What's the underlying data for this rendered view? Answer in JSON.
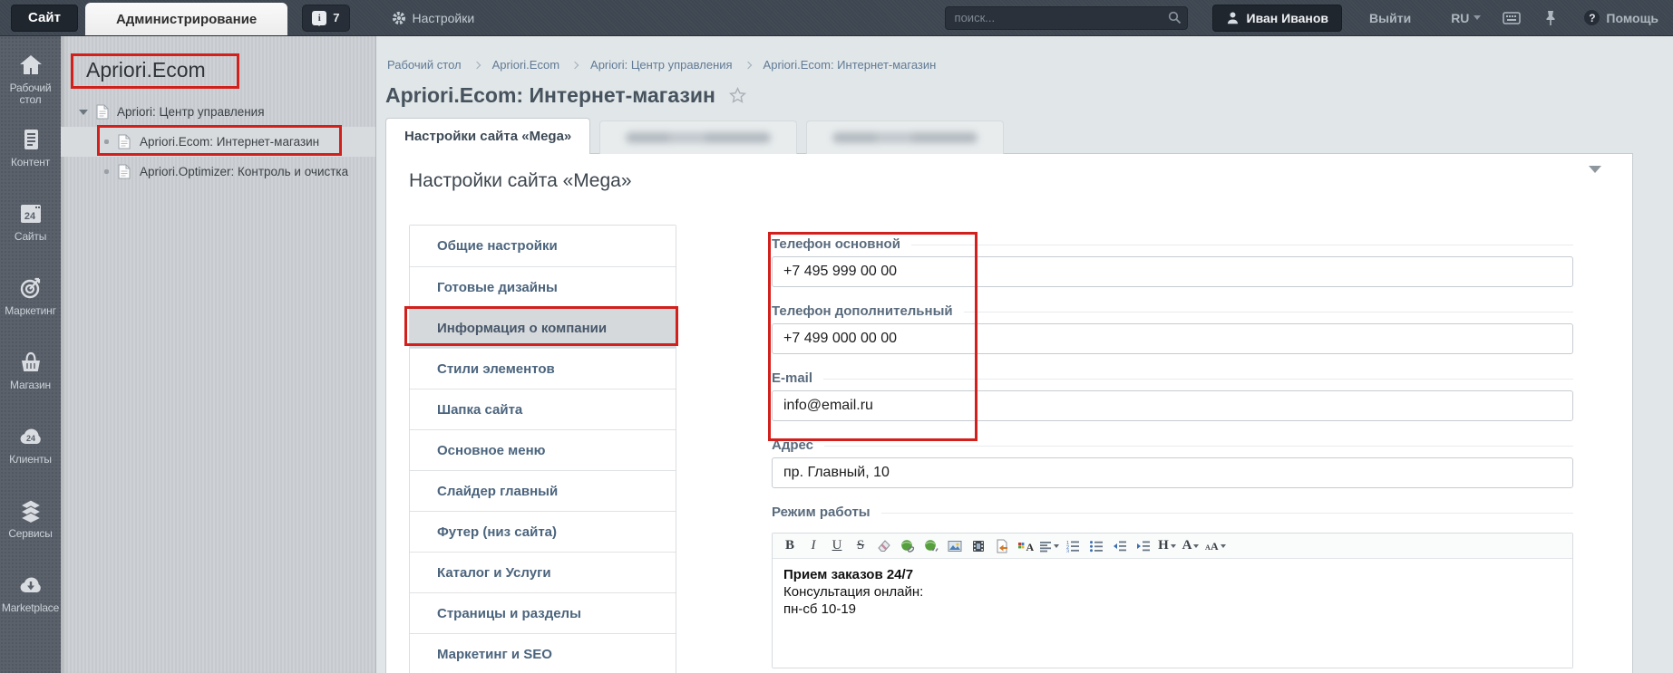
{
  "topbar": {
    "site_tab": "Сайт",
    "admin_tab": "Администрирование",
    "notification_count": "7",
    "settings_label": "Настройки",
    "search_placeholder": "поиск...",
    "user_name": "Иван Иванов",
    "logout_label": "Выйти",
    "language": "RU",
    "help_label": "Помощь"
  },
  "sidebar": {
    "items": [
      {
        "label": "Рабочий стол",
        "icon": "home-icon"
      },
      {
        "label": "Контент",
        "icon": "content-icon"
      },
      {
        "label": "Сайты",
        "icon": "sites-icon",
        "badge": "24"
      },
      {
        "label": "Маркетинг",
        "icon": "marketing-icon"
      },
      {
        "label": "Магазин",
        "icon": "store-icon"
      },
      {
        "label": "Клиенты",
        "icon": "clients-icon",
        "badge": "24"
      },
      {
        "label": "Сервисы",
        "icon": "services-icon"
      },
      {
        "label": "Marketplace",
        "icon": "marketplace-icon"
      }
    ]
  },
  "tree": {
    "title": "Apriori.Ecom",
    "items": [
      {
        "label": "Apriori: Центр управления",
        "selected": false
      },
      {
        "label": "Apriori.Ecom: Интернет-магазин",
        "selected": true
      },
      {
        "label": "Apriori.Optimizer: Контроль и очистка",
        "selected": false
      }
    ]
  },
  "breadcrumb": {
    "items": [
      "Рабочий стол",
      "Apriori.Ecom",
      "Apriori: Центр управления",
      "Apriori.Ecom: Интернет-магазин"
    ]
  },
  "page": {
    "title": "Apriori.Ecom: Интернет-магазин"
  },
  "tabs": [
    {
      "label": "Настройки сайта «Mega»",
      "active": true,
      "blurred": false
    },
    {
      "label": "",
      "active": false,
      "blurred": true
    },
    {
      "label": "",
      "active": false,
      "blurred": true
    }
  ],
  "panel": {
    "heading": "Настройки сайта «Mega»"
  },
  "settings_menu": {
    "selected": "Информация о компании",
    "items": [
      "Общие настройки",
      "Готовые дизайны",
      "Информация о компании",
      "Стили элементов",
      "Шапка сайта",
      "Основное меню",
      "Слайдер главный",
      "Футер (низ сайта)",
      "Каталог и Услуги",
      "Страницы и разделы",
      "Маркетинг и SEO"
    ]
  },
  "form": {
    "fields": [
      {
        "label": "Телефон основной",
        "value": "+7 495 999 00 00"
      },
      {
        "label": "Телефон дополнительный",
        "value": "+7 499 000 00 00"
      },
      {
        "label": "E-mail",
        "value": "info@email.ru"
      },
      {
        "label": "Адрес",
        "value": "пр. Главный, 10"
      }
    ],
    "editor": {
      "label": "Режим работы",
      "toolbar": [
        {
          "name": "bold-icon",
          "glyph": "B"
        },
        {
          "name": "italic-icon",
          "glyph": "I"
        },
        {
          "name": "underline-icon",
          "glyph": "U"
        },
        {
          "name": "strikethrough-icon",
          "glyph": "S"
        },
        {
          "name": "remove-format-icon",
          "glyph": ""
        },
        {
          "name": "insert-link-icon",
          "glyph": ""
        },
        {
          "name": "remove-link-icon",
          "glyph": ""
        },
        {
          "name": "insert-image-icon",
          "glyph": ""
        },
        {
          "name": "insert-video-icon",
          "glyph": ""
        },
        {
          "name": "insert-snippet-icon",
          "glyph": ""
        },
        {
          "name": "font-color-icon",
          "glyph": "A"
        },
        {
          "name": "align-icon",
          "glyph": ""
        },
        {
          "name": "ordered-list-icon",
          "glyph": ""
        },
        {
          "name": "unordered-list-icon",
          "glyph": ""
        },
        {
          "name": "outdent-icon",
          "glyph": ""
        },
        {
          "name": "indent-icon",
          "glyph": ""
        },
        {
          "name": "heading-icon",
          "glyph": "H"
        },
        {
          "name": "font-size-icon",
          "glyph": "A"
        },
        {
          "name": "text-case-icon",
          "glyph": ""
        }
      ],
      "lines": [
        {
          "text": "Прием заказов 24/7",
          "bold": true
        },
        {
          "text": "Консультация онлайн:",
          "bold": false
        },
        {
          "text": "пн-сб 10-19",
          "bold": false
        }
      ]
    }
  },
  "colors": {
    "annotation": "#d2201c",
    "topbar_bg": "#3e4751",
    "sidebar_bg": "#5a616b",
    "tree_bg": "#c9cdd1",
    "selected_row": "#d5d9dc",
    "panel_bg": "#ffffff"
  }
}
